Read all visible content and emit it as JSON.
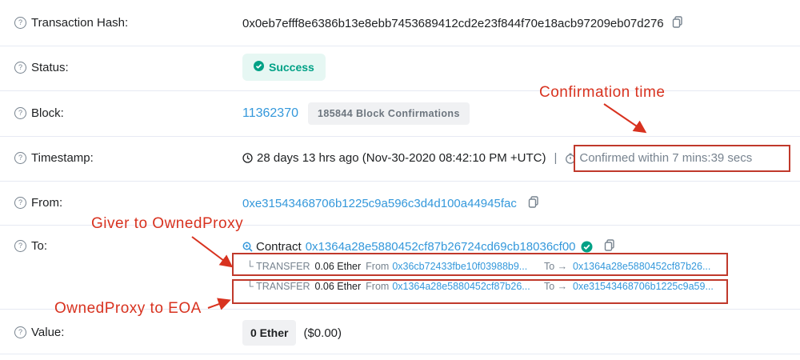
{
  "rows": {
    "hash": {
      "label": "Transaction Hash:",
      "value": "0x0eb7efff8e6386b13e8ebb7453689412cd2e23f844f70e18acb97209eb07d276"
    },
    "status": {
      "label": "Status:",
      "value": "Success"
    },
    "block": {
      "label": "Block:",
      "value": "11362370",
      "confirmations": "185844 Block Confirmations"
    },
    "timestamp": {
      "label": "Timestamp:",
      "value": "28 days 13 hrs ago (Nov-30-2020 08:42:10 PM +UTC)",
      "separator": "|",
      "confirmed": "Confirmed within 7 mins:39 secs"
    },
    "from": {
      "label": "From:",
      "value": "0xe31543468706b1225c9a596c3d4d100a44945fac"
    },
    "to": {
      "label": "To:",
      "contract_label": "Contract",
      "contract_address": "0x1364a28e5880452cf87b26724cd69cb18036cf00",
      "transfers": [
        {
          "tag": "└ TRANSFER",
          "amount": "0.06 Ether",
          "from_label": "From",
          "from": "0x36cb72433fbe10f03988b9...",
          "to_label": "To →",
          "to": "0x1364a28e5880452cf87b26..."
        },
        {
          "tag": "└ TRANSFER",
          "amount": "0.06 Ether",
          "from_label": "From",
          "from": "0x1364a28e5880452cf87b26...",
          "to_label": "To →",
          "to": "0xe31543468706b1225c9a59..."
        }
      ]
    },
    "value": {
      "label": "Value:",
      "amount": "0 Ether",
      "usd": "($0.00)"
    }
  },
  "annotations": {
    "confirmation_time": "Confirmation time",
    "giver": "Giver to OwnedProxy",
    "proxy_to_eoa": "OwnedProxy to EOA"
  },
  "colors": {
    "link": "#3498db",
    "success": "#00a186",
    "annotation": "#d8321f"
  },
  "icons": [
    "help-icon",
    "copy-icon",
    "check-circle-icon",
    "clock-icon",
    "timer-icon",
    "zoom-icon",
    "verified-icon"
  ]
}
